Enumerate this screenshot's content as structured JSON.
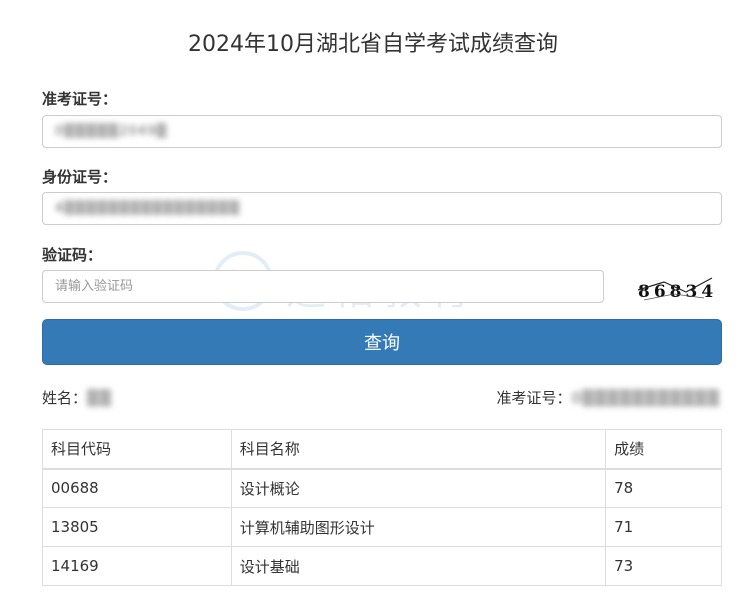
{
  "page": {
    "title": "2024年10月湖北省自学考试成绩查询"
  },
  "form": {
    "exam_no_label": "准考证号：",
    "exam_no_value": "0▒▒▒▒▒2049▒",
    "id_label": "身份证号：",
    "id_value": "4▒▒▒▒▒▒▒▒▒▒▒▒▒▒▒▒",
    "captcha_label": "验证码：",
    "captcha_placeholder": "请输入验证码",
    "captcha_code": "86834",
    "query_button": "查询"
  },
  "watermark": {
    "text": "远佑教育"
  },
  "result": {
    "name_label": "姓名：",
    "name_value": "▒▒",
    "exam_no_label": "准考证号：",
    "exam_no_value": "0▒▒▒▒▒▒▒▒▒▒▒",
    "columns": [
      "科目代码",
      "科目名称",
      "成绩"
    ],
    "rows": [
      {
        "code": "00688",
        "name": "设计概论",
        "score": "78"
      },
      {
        "code": "13805",
        "name": "计算机辅助图形设计",
        "score": "71"
      },
      {
        "code": "14169",
        "name": "设计基础",
        "score": "73"
      }
    ]
  },
  "colors": {
    "primary": "#337ab7",
    "border": "#cccccc",
    "text": "#333333"
  },
  "icons": {
    "watermark_logo": "water-drop-logo-icon"
  }
}
